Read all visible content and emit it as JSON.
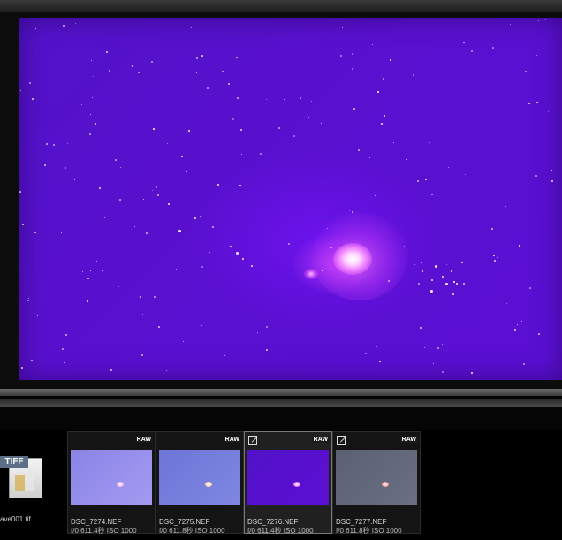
{
  "viewer": {
    "colors": {
      "sky": "#5a10cf",
      "nebula": "#f080ff"
    }
  },
  "filmstrip": {
    "file_tile": {
      "badge": "TIFF",
      "name": "ave001.tif",
      "icon": "tiff-file-icon"
    },
    "thumbnails": [
      {
        "name": "DSC_7274.NEF",
        "meta": "f/0 611.4秒 ISO 1000",
        "badge": "RAW",
        "edited": false,
        "selected": false
      },
      {
        "name": "DSC_7275.NEF",
        "meta": "f/0 611.8秒 ISO 1000",
        "badge": "RAW",
        "edited": false,
        "selected": false
      },
      {
        "name": "DSC_7276.NEF",
        "meta": "f/0 611.4秒 ISO 1000",
        "badge": "RAW",
        "edited": true,
        "selected": true
      },
      {
        "name": "DSC_7277.NEF",
        "meta": "f/0 611.8秒 ISO 1000",
        "badge": "RAW",
        "edited": true,
        "selected": false
      }
    ]
  }
}
